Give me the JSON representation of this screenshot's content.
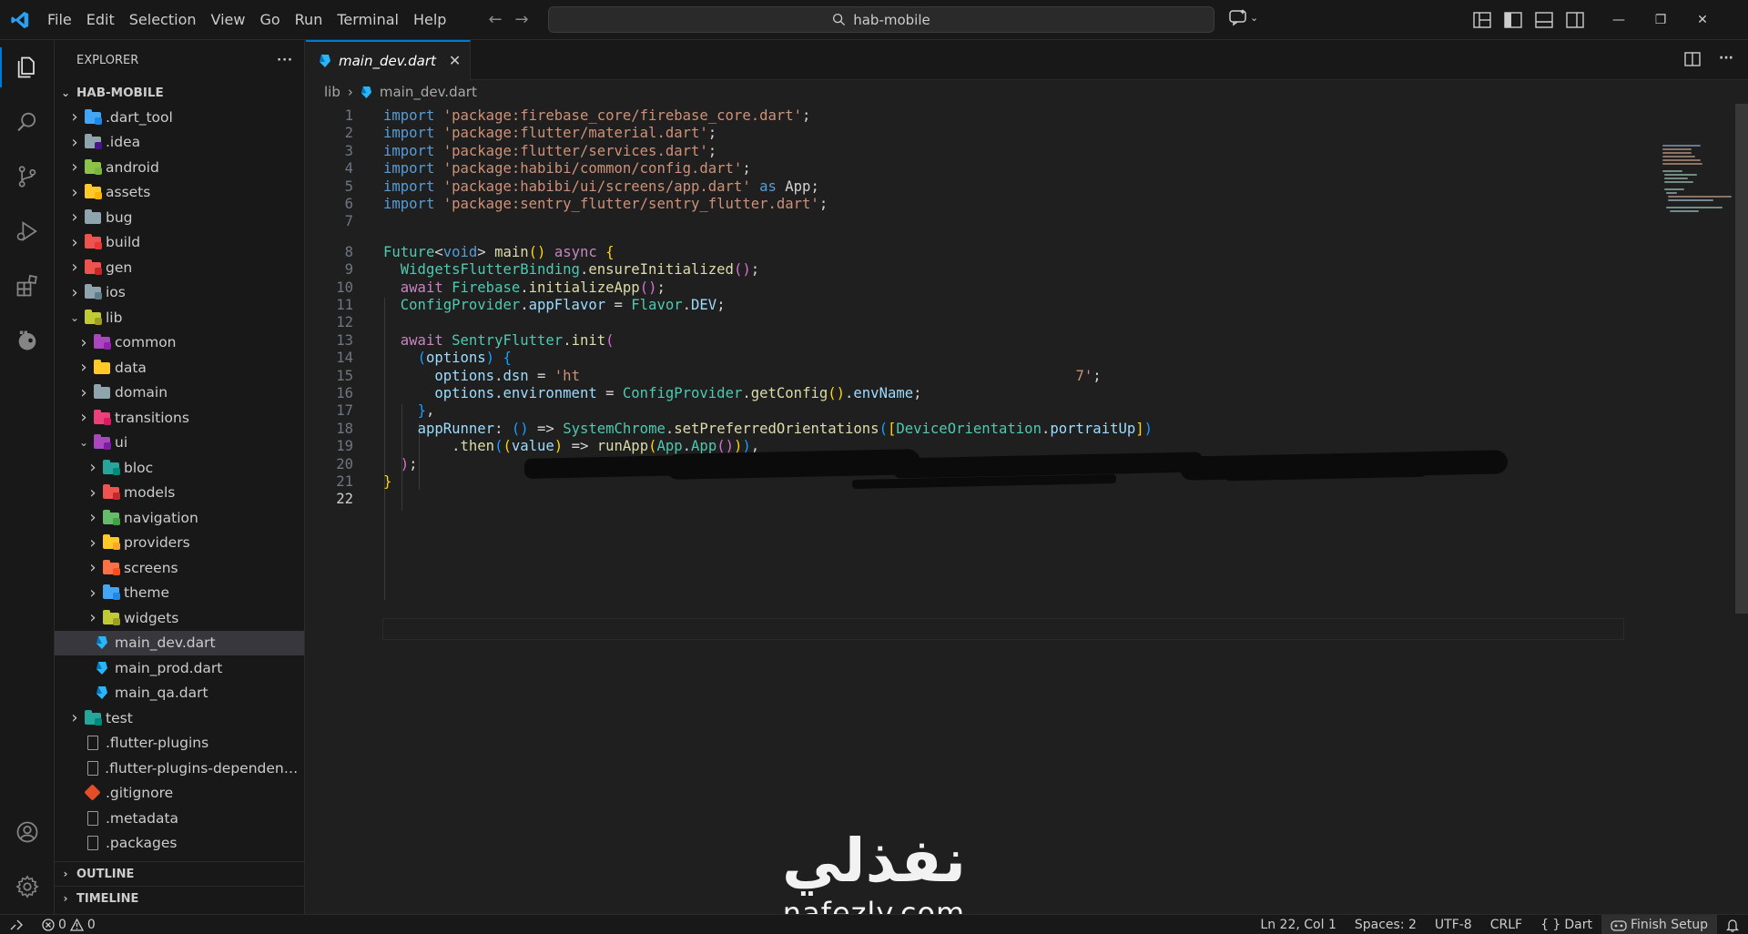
{
  "window": {
    "search_text": "hab-mobile"
  },
  "menu": [
    "File",
    "Edit",
    "Selection",
    "View",
    "Go",
    "Run",
    "Terminal",
    "Help"
  ],
  "sidebar": {
    "title": "EXPLORER",
    "more": "···",
    "root": "HAB-MOBILE",
    "items": [
      {
        "label": ".dart_tool",
        "depth": 1,
        "chevron": "right",
        "kind": "folder",
        "color": "#42a5f5",
        "badge": "#1e88e5"
      },
      {
        "label": ".idea",
        "depth": 1,
        "chevron": "right",
        "kind": "folder",
        "color": "#90a4ae",
        "badge": "#4a148c"
      },
      {
        "label": "android",
        "depth": 1,
        "chevron": "right",
        "kind": "folder",
        "color": "#8bc34a",
        "badge": "#7cb342"
      },
      {
        "label": "assets",
        "depth": 1,
        "chevron": "right",
        "kind": "folder",
        "color": "#ffca28",
        "badge": "#ffb300"
      },
      {
        "label": "bug",
        "depth": 1,
        "chevron": "right",
        "kind": "folder",
        "color": "#90a4ae",
        "badge": ""
      },
      {
        "label": "build",
        "depth": 1,
        "chevron": "right",
        "kind": "folder",
        "color": "#ef5350",
        "badge": "#e53935"
      },
      {
        "label": "gen",
        "depth": 1,
        "chevron": "right",
        "kind": "folder",
        "color": "#ef5350",
        "badge": "#c62828"
      },
      {
        "label": "ios",
        "depth": 1,
        "chevron": "right",
        "kind": "folder",
        "color": "#90a4ae",
        "badge": "#607d8b"
      },
      {
        "label": "lib",
        "depth": 1,
        "chevron": "down",
        "kind": "folder",
        "color": "#c0ca33",
        "badge": "#9e9d24"
      },
      {
        "label": "common",
        "depth": 2,
        "chevron": "right",
        "kind": "folder",
        "color": "#ab47bc",
        "badge": "#8e24aa"
      },
      {
        "label": "data",
        "depth": 2,
        "chevron": "right",
        "kind": "folder",
        "color": "#ffca28",
        "badge": ""
      },
      {
        "label": "domain",
        "depth": 2,
        "chevron": "right",
        "kind": "folder",
        "color": "#90a4ae",
        "badge": ""
      },
      {
        "label": "transitions",
        "depth": 2,
        "chevron": "right",
        "kind": "folder",
        "color": "#ec407a",
        "badge": "#d81b60"
      },
      {
        "label": "ui",
        "depth": 2,
        "chevron": "down",
        "kind": "folder",
        "color": "#ab47bc",
        "badge": "#7b1fa2"
      },
      {
        "label": "bloc",
        "depth": 3,
        "chevron": "right",
        "kind": "folder",
        "color": "#26a69a",
        "badge": "#00897b"
      },
      {
        "label": "models",
        "depth": 3,
        "chevron": "right",
        "kind": "folder",
        "color": "#ef5350",
        "badge": "#c62828"
      },
      {
        "label": "navigation",
        "depth": 3,
        "chevron": "right",
        "kind": "folder",
        "color": "#66bb6a",
        "badge": "#43a047"
      },
      {
        "label": "providers",
        "depth": 3,
        "chevron": "right",
        "kind": "folder",
        "color": "#ffca28",
        "badge": "#f9a825"
      },
      {
        "label": "screens",
        "depth": 3,
        "chevron": "right",
        "kind": "folder",
        "color": "#ff7043",
        "badge": "#f4511e"
      },
      {
        "label": "theme",
        "depth": 3,
        "chevron": "right",
        "kind": "folder",
        "color": "#42a5f5",
        "badge": "#1e88e5"
      },
      {
        "label": "widgets",
        "depth": 3,
        "chevron": "right",
        "kind": "folder",
        "color": "#c0ca33",
        "badge": "#9e9d24"
      },
      {
        "label": "main_dev.dart",
        "depth": 2,
        "chevron": "",
        "kind": "dart",
        "selected": true
      },
      {
        "label": "main_prod.dart",
        "depth": 2,
        "chevron": "",
        "kind": "dart"
      },
      {
        "label": "main_qa.dart",
        "depth": 2,
        "chevron": "",
        "kind": "dart"
      },
      {
        "label": "test",
        "depth": 1,
        "chevron": "right",
        "kind": "folder",
        "color": "#26a69a",
        "badge": "#00897b"
      },
      {
        "label": ".flutter-plugins",
        "depth": 1,
        "chevron": "",
        "kind": "file"
      },
      {
        "label": ".flutter-plugins-dependenci...",
        "depth": 1,
        "chevron": "",
        "kind": "file"
      },
      {
        "label": ".gitignore",
        "depth": 1,
        "chevron": "",
        "kind": "git"
      },
      {
        "label": ".metadata",
        "depth": 1,
        "chevron": "",
        "kind": "file"
      },
      {
        "label": ".packages",
        "depth": 1,
        "chevron": "",
        "kind": "file"
      }
    ],
    "outline": "OUTLINE",
    "timeline": "TIMELINE"
  },
  "editor": {
    "tab": "main_dev.dart",
    "breadcrumb": [
      "lib",
      "main_dev.dart"
    ],
    "line_numbers": [
      "1",
      "2",
      "3",
      "4",
      "5",
      "6",
      "7",
      "8",
      "9",
      "10",
      "11",
      "12",
      "13",
      "14",
      "15",
      "16",
      "17",
      "18",
      "19",
      "20",
      "21",
      "22"
    ],
    "code_lines": [
      [
        [
          "kw",
          "import"
        ],
        [
          "pl",
          " "
        ],
        [
          "str",
          "'package:firebase_core/firebase_core.dart'"
        ],
        [
          "pl",
          ";"
        ]
      ],
      [
        [
          "kw",
          "import"
        ],
        [
          "pl",
          " "
        ],
        [
          "str",
          "'package:flutter/material.dart'"
        ],
        [
          "pl",
          ";"
        ]
      ],
      [
        [
          "kw",
          "import"
        ],
        [
          "pl",
          " "
        ],
        [
          "str",
          "'package:flutter/services.dart'"
        ],
        [
          "pl",
          ";"
        ]
      ],
      [
        [
          "kw",
          "import"
        ],
        [
          "pl",
          " "
        ],
        [
          "str",
          "'package:habibi/common/config.dart'"
        ],
        [
          "pl",
          ";"
        ]
      ],
      [
        [
          "kw",
          "import"
        ],
        [
          "pl",
          " "
        ],
        [
          "str",
          "'package:habibi/ui/screens/app.dart'"
        ],
        [
          "pl",
          " "
        ],
        [
          "kw",
          "as"
        ],
        [
          "pl",
          " App;"
        ]
      ],
      [
        [
          "kw",
          "import"
        ],
        [
          "pl",
          " "
        ],
        [
          "str",
          "'package:sentry_flutter/sentry_flutter.dart'"
        ],
        [
          "pl",
          ";"
        ]
      ],
      [],
      [
        [
          "cls",
          "Future"
        ],
        [
          "pl",
          "<"
        ],
        [
          "kw",
          "void"
        ],
        [
          "pl",
          "> "
        ],
        [
          "fn",
          "main"
        ],
        [
          "p1",
          "()"
        ],
        [
          "pl",
          " "
        ],
        [
          "ctl",
          "async"
        ],
        [
          "pl",
          " "
        ],
        [
          "p1",
          "{"
        ]
      ],
      [
        [
          "pl",
          "  "
        ],
        [
          "cls",
          "WidgetsFlutterBinding"
        ],
        [
          "pl",
          "."
        ],
        [
          "fn",
          "ensureInitialized"
        ],
        [
          "p2",
          "()"
        ],
        [
          "pl",
          ";"
        ]
      ],
      [
        [
          "pl",
          "  "
        ],
        [
          "ctl",
          "await"
        ],
        [
          "pl",
          " "
        ],
        [
          "cls",
          "Firebase"
        ],
        [
          "pl",
          "."
        ],
        [
          "fn",
          "initializeApp"
        ],
        [
          "p2",
          "()"
        ],
        [
          "pl",
          ";"
        ]
      ],
      [
        [
          "pl",
          "  "
        ],
        [
          "cls",
          "ConfigProvider"
        ],
        [
          "pl",
          "."
        ],
        [
          "prop",
          "appFlavor"
        ],
        [
          "pl",
          " = "
        ],
        [
          "cls",
          "Flavor"
        ],
        [
          "pl",
          "."
        ],
        [
          "prop",
          "DEV"
        ],
        [
          "pl",
          ";"
        ]
      ],
      [],
      [
        [
          "pl",
          "  "
        ],
        [
          "ctl",
          "await"
        ],
        [
          "pl",
          " "
        ],
        [
          "cls",
          "SentryFlutter"
        ],
        [
          "pl",
          "."
        ],
        [
          "fn",
          "init"
        ],
        [
          "p2",
          "("
        ]
      ],
      [
        [
          "pl",
          "    "
        ],
        [
          "p3",
          "("
        ],
        [
          "var",
          "options"
        ],
        [
          "p3",
          ")"
        ],
        [
          "pl",
          " "
        ],
        [
          "p3",
          "{"
        ]
      ],
      [
        [
          "pl",
          "      "
        ],
        [
          "var",
          "options"
        ],
        [
          "pl",
          "."
        ],
        [
          "prop",
          "dsn"
        ],
        [
          "pl",
          " = "
        ],
        [
          "str",
          "'ht                                                          7'"
        ],
        [
          "pl",
          ";"
        ]
      ],
      [
        [
          "pl",
          "      "
        ],
        [
          "var",
          "options"
        ],
        [
          "pl",
          "."
        ],
        [
          "prop",
          "environment"
        ],
        [
          "pl",
          " = "
        ],
        [
          "cls",
          "ConfigProvider"
        ],
        [
          "pl",
          "."
        ],
        [
          "fn",
          "getConfig"
        ],
        [
          "p1",
          "()"
        ],
        [
          "pl",
          "."
        ],
        [
          "prop",
          "envName"
        ],
        [
          "pl",
          ";"
        ]
      ],
      [
        [
          "pl",
          "    "
        ],
        [
          "p3",
          "}"
        ],
        [
          "pl",
          ","
        ]
      ],
      [
        [
          "pl",
          "    "
        ],
        [
          "prop",
          "appRunner"
        ],
        [
          "pl",
          ": "
        ],
        [
          "p3",
          "()"
        ],
        [
          "pl",
          " => "
        ],
        [
          "cls",
          "SystemChrome"
        ],
        [
          "pl",
          "."
        ],
        [
          "fn",
          "setPreferredOrientations"
        ],
        [
          "p3",
          "("
        ],
        [
          "p1",
          "["
        ],
        [
          "cls",
          "DeviceOrientation"
        ],
        [
          "pl",
          "."
        ],
        [
          "prop",
          "portraitUp"
        ],
        [
          "p1",
          "]"
        ],
        [
          "p3",
          ")"
        ]
      ],
      [
        [
          "pl",
          "        ."
        ],
        [
          "fn",
          "then"
        ],
        [
          "p3",
          "("
        ],
        [
          "p1",
          "("
        ],
        [
          "var",
          "value"
        ],
        [
          "p1",
          ")"
        ],
        [
          "pl",
          " => "
        ],
        [
          "fn",
          "runApp"
        ],
        [
          "p1",
          "("
        ],
        [
          "cls",
          "App"
        ],
        [
          "pl",
          "."
        ],
        [
          "cls",
          "App"
        ],
        [
          "p2",
          "()"
        ],
        [
          "p1",
          ")"
        ],
        [
          "p3",
          ")"
        ],
        [
          "pl",
          ","
        ]
      ],
      [
        [
          "pl",
          "  "
        ],
        [
          "p2",
          ")"
        ],
        [
          "pl",
          ";"
        ]
      ],
      [
        [
          "p1",
          "}"
        ]
      ],
      []
    ]
  },
  "watermark": {
    "arabic": "نفذلي",
    "latin": "nafezly.com"
  },
  "statusbar": {
    "errors": "0",
    "warnings": "0",
    "position": "Ln 22, Col 1",
    "spaces": "Spaces: 2",
    "encoding": "UTF-8",
    "eol": "CRLF",
    "braces": "{ }",
    "language": "Dart",
    "finish_setup": "Finish Setup"
  },
  "colors": {
    "accent": "#0078d4",
    "background": "#1f1f1f",
    "sidebar": "#181818"
  }
}
